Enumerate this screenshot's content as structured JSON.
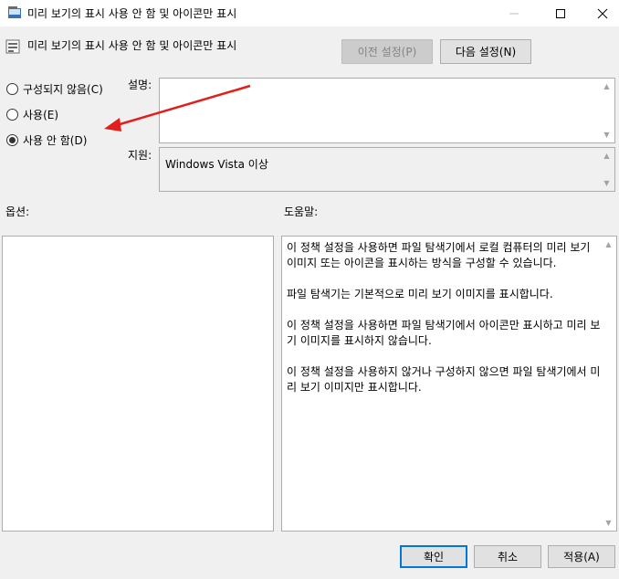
{
  "window": {
    "title": "미리 보기의 표시 사용 안 함 및 아이콘만 표시",
    "minimize_glyph": "—",
    "maximize_glyph": "☐",
    "close_glyph": "✕"
  },
  "header": {
    "title": "미리 보기의 표시 사용 안 함 및 아이콘만 표시",
    "prev_setting_label": "이전 설정(P)",
    "next_setting_label": "다음 설정(N)"
  },
  "options": [
    {
      "label": "구성되지 않음(C)",
      "checked": false
    },
    {
      "label": "사용(E)",
      "checked": false
    },
    {
      "label": "사용 안 함(D)",
      "checked": true
    }
  ],
  "comment": {
    "label": "설명:",
    "value": ""
  },
  "supported_on": {
    "label": "지원:",
    "value": "Windows Vista 이상"
  },
  "options_section": {
    "label": "옵션:"
  },
  "help_section": {
    "label": "도움말:",
    "text": "이 정책 설정을 사용하면 파일 탐색기에서 로컬 컴퓨터의 미리 보기 이미지 또는 아이콘을 표시하는 방식을 구성할 수 있습니다.\n\n파일 탐색기는 기본적으로 미리 보기 이미지를 표시합니다.\n\n이 정책 설정을 사용하면 파일 탐색기에서 아이콘만 표시하고 미리 보기 이미지를 표시하지 않습니다.\n\n이 정책 설정을 사용하지 않거나 구성하지 않으면 파일 탐색기에서 미리 보기 이미지만 표시합니다."
  },
  "footer": {
    "ok_label": "확인",
    "cancel_label": "취소",
    "apply_label": "적용(A)"
  },
  "colors": {
    "annotation_arrow": "#e0201c",
    "focus_border": "#0078d7",
    "dialog_background": "#f0f0f0"
  }
}
